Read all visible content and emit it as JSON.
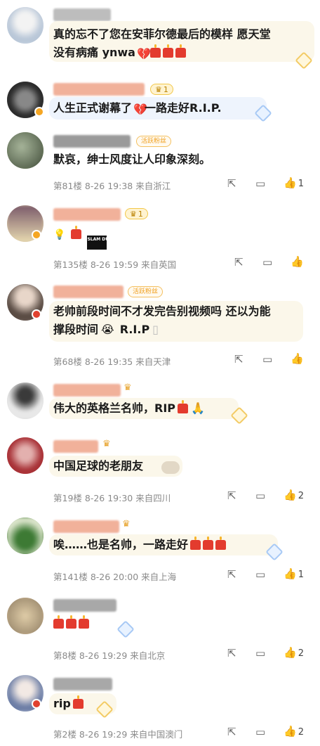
{
  "comments": [
    {
      "text": "真的忘不了您在安菲尔德最后的模样 愿天堂",
      "text2": "没有病痛 ynwa",
      "meta": "",
      "likes": ""
    },
    {
      "text": "人生正式谢幕了",
      "text_after": "一路走好R.I.P.",
      "meta": "",
      "likes": ""
    },
    {
      "fan_badge": "活跃粉丝",
      "text": "默哀，绅士风度让人印象深刻。",
      "meta": "第81楼 8-26 19:38 来自浙江",
      "likes": "1"
    },
    {
      "text": "",
      "meta": "第135楼 8-26 19:59 来自英国",
      "likes": "",
      "slam_label": "SLAM DUNK"
    },
    {
      "fan_badge": "活跃粉丝",
      "text": "老帅前段时间不才发完告别视频吗 还以为能",
      "text2": "撑段时间",
      "text2_after": "R.I.P",
      "meta": "第68楼 8-26 19:35 来自天津",
      "likes": ""
    },
    {
      "text": "伟大的英格兰名帅，RIP",
      "meta": "",
      "likes": ""
    },
    {
      "text": "中国足球的老朋友",
      "meta": "第19楼 8-26 19:30 来自四川",
      "likes": "2"
    },
    {
      "text": "唉……也是名帅，一路走好",
      "meta": "第141楼 8-26 20:00 来自上海",
      "likes": "1"
    },
    {
      "text": "",
      "meta": "第8楼 8-26 19:29 来自北京",
      "likes": "2"
    },
    {
      "text": "rip",
      "meta": "第2楼 8-26 19:29 来自中国澳门",
      "likes": "2"
    }
  ],
  "rank_badge": "1",
  "colors": {
    "bubble": "#fbf7ea",
    "meta": "#8a8a8a",
    "fan_badge": "#f0a020"
  }
}
